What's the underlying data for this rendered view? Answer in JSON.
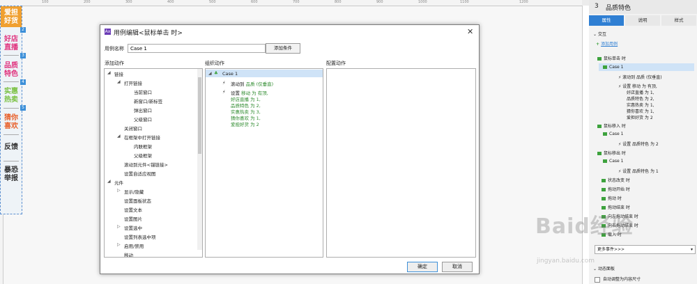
{
  "ruler": {
    "ticks": [
      "100",
      "200",
      "300",
      "400",
      "500",
      "600",
      "700",
      "800",
      "900",
      "1000",
      "1100",
      "1200"
    ]
  },
  "left_nav": {
    "items": [
      {
        "label1": "爱担",
        "label2": "好货",
        "color": "#ffffff",
        "bg": "#f0a030"
      },
      {
        "label1": "好店",
        "label2": "直播",
        "color": "#e0317d",
        "bg": ""
      },
      {
        "label1": "品质",
        "label2": "特色",
        "color": "#e0317d",
        "bg": ""
      },
      {
        "label1": "实惠",
        "label2": "热卖",
        "color": "#7ac142",
        "bg": ""
      },
      {
        "label1": "猜你",
        "label2": "喜欢",
        "color": "#e8612c",
        "bg": ""
      },
      {
        "label1": "反馈",
        "label2": "",
        "color": "#333333",
        "bg": ""
      },
      {
        "label1": "暴恐",
        "label2": "举报",
        "color": "#333333",
        "bg": ""
      }
    ],
    "numbers": [
      "2",
      "3",
      "4",
      "5"
    ]
  },
  "dialog": {
    "title": "用例编辑<鼠标单击 时>",
    "case_name_label": "用例名称",
    "case_name_value": "Case 1",
    "add_condition_label": "添加条件",
    "add_action_label": "添加动作",
    "organize_action_label": "组织动作",
    "configure_action_label": "配置动作",
    "tree": [
      "链接",
      "打开链接",
      "当前窗口",
      "新窗口/新标签",
      "弹出窗口",
      "父级窗口",
      "关闭窗口",
      "在框架中打开链接",
      "内联框架",
      "父级框架",
      "滚动到元件<锚链接>",
      "设置自适应视图",
      "元件",
      "显示/隐藏",
      "设置面板状态",
      "设置文本",
      "设置图片",
      "设置选中",
      "设置列表选中项",
      "启用/禁用",
      "移动"
    ],
    "organize": {
      "case": "Case 1",
      "action1_prefix": "滚动到 ",
      "action1_target": "品质 (仅垂直)",
      "action2_prefix": "设置 ",
      "action2_lines": [
        "移动 为 有顶,",
        "好店直播 为 1,",
        "品质特色 为 2,",
        "实惠热卖 为 3,",
        "猜你喜欢 为 1,",
        "爱担好货 为 2"
      ]
    },
    "ok_label": "确定",
    "cancel_label": "取消"
  },
  "right_panel": {
    "page_number": "3",
    "page_title": "品质特色",
    "tabs": [
      "属性",
      "说明",
      "样式"
    ],
    "section_interaction": "交互",
    "add_case_label": "添加用例",
    "rows": [
      {
        "text": "鼠标单击 时",
        "green": false
      },
      {
        "text": "Case 1",
        "green": false
      },
      {
        "text": "滚动到 品质 (仅垂直)",
        "green": true
      },
      {
        "text": "设置 移动 为 有顶,",
        "green": true
      },
      {
        "text": "好店直播 为 1,",
        "green": true
      },
      {
        "text": "品质特色 为 2,",
        "green": true
      },
      {
        "text": "实惠热卖 为 1,",
        "green": true
      },
      {
        "text": "猜你喜欢 为 1,",
        "green": true
      },
      {
        "text": "爱担好货 为 2",
        "green": true
      },
      {
        "text": "鼠标移入 时",
        "green": false
      },
      {
        "text": "Case 1",
        "green": false
      },
      {
        "text": "设置 品质特色 为 2",
        "green": true
      },
      {
        "text": "鼠标移出 时",
        "green": false
      },
      {
        "text": "Case 1",
        "green": false
      },
      {
        "text": "设置 品质特色 为 1",
        "green": true
      },
      {
        "text": "状态改变 时",
        "green": false
      },
      {
        "text": "拖动开始 时",
        "green": false
      },
      {
        "text": "拖动 时",
        "green": false
      },
      {
        "text": "拖动结束 时",
        "green": false
      },
      {
        "text": "向左拖动结束 时",
        "green": false
      },
      {
        "text": "向右拖动结束 时",
        "green": false
      },
      {
        "text": "载入 时",
        "green": false
      }
    ],
    "more_events": "更多事件>>>",
    "section_dynamic_panel": "动态面板",
    "auto_fit_label": "自动调整为内容尺寸"
  },
  "watermark": {
    "main": "Baid经验",
    "sub": "jingyan.baidu.com"
  },
  "colors": {
    "accent": "#2f7fd3",
    "green": "#2e8b2e",
    "selection": "#cfe3f7"
  }
}
